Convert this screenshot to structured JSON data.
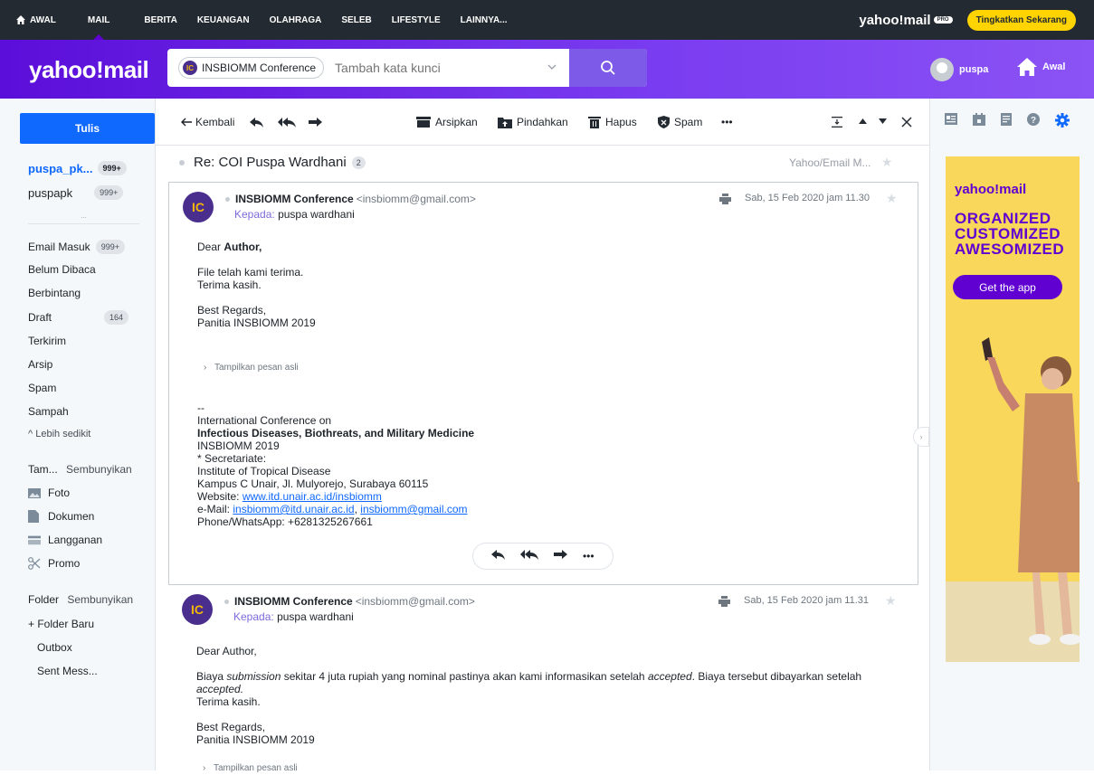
{
  "topnav": {
    "items": [
      "AWAL",
      "MAIL",
      "BERITA",
      "KEUANGAN",
      "OLAHRAGA",
      "SELEB",
      "LIFESTYLE",
      "LAINNYA..."
    ],
    "brand": "yahoo!mail",
    "pro": "PRO",
    "upgrade": "Tingkatkan Sekarang"
  },
  "header": {
    "logo": "yahoo!mail",
    "search_chip": "INSBIOMM Conference",
    "chip_avatar": "IC",
    "search_placeholder": "Tambah kata kunci",
    "user": "puspa",
    "home": "Awal"
  },
  "sidebar": {
    "compose": "Tulis",
    "accounts": [
      {
        "name": "puspa_pk...",
        "badge": "999+"
      },
      {
        "name": "puspapk",
        "badge": "999+"
      }
    ],
    "more": "...",
    "folders": [
      {
        "label": "Email Masuk",
        "badge": "999+"
      },
      {
        "label": "Belum Dibaca",
        "badge": ""
      },
      {
        "label": "Berbintang",
        "badge": ""
      },
      {
        "label": "Draft",
        "badge": "164"
      },
      {
        "label": "Terkirim",
        "badge": ""
      },
      {
        "label": "Arsip",
        "badge": ""
      },
      {
        "label": "Spam",
        "badge": ""
      },
      {
        "label": "Sampah",
        "badge": ""
      }
    ],
    "less": "^ Lebih sedikit",
    "views_title": "Tam...",
    "views_hide": "Sembunyikan",
    "views": [
      "Foto",
      "Dokumen",
      "Langganan",
      "Promo"
    ],
    "folder_title": "Folder",
    "folder_hide": "Sembunyikan",
    "new_folder": "+ Folder Baru",
    "custom_folders": [
      "Outbox",
      "Sent Mess..."
    ]
  },
  "toolbar": {
    "back": "Kembali",
    "archive": "Arsipkan",
    "move": "Pindahkan",
    "delete": "Hapus",
    "spam": "Spam",
    "more": "•••"
  },
  "thread": {
    "subject": "Re: COI Puspa Wardhani",
    "count": "2",
    "folder": "Yahoo/Email M...",
    "messages": [
      {
        "avatar": "IC",
        "sender": "INSBIOMM Conference",
        "email": "<insbiomm@gmail.com>",
        "to_label": "Kepada:",
        "to": "puspa wardhani",
        "date": "Sab, 15 Feb 2020 jam 11.30",
        "greeting": "Dear",
        "greeting_bold": "Author,",
        "line1": "File telah kami terima.",
        "line2": "Terima kasih.",
        "regards1": "Best Regards,",
        "regards2": "Panitia INSBIOMM 2019",
        "show_original": "Tampilkan pesan asli",
        "sig_dash": "--",
        "sig1": "International Conference on",
        "sig2": "Infectious Diseases, Biothreats, and Military Medicine",
        "sig3": "INSBIOMM 2019",
        "sig4": "* Secretariate:",
        "sig5": "Institute of Tropical Disease",
        "sig6": "Kampus C Unair, Jl. Mulyorejo, Surabaya 60115",
        "sig_web_label": "Website:",
        "sig_web": "www.itd.unair.ac.id/insbiomm",
        "sig_mail_label": "e-Mail:",
        "sig_mail1": "insbiomm@itd.unair.ac.id",
        "sig_mail2": "insbiomm@gmail.com",
        "sig_phone": "Phone/WhatsApp: +6281325267661"
      },
      {
        "avatar": "IC",
        "sender": "INSBIOMM Conference",
        "email": "<insbiomm@gmail.com>",
        "to_label": "Kepada:",
        "to": "puspa wardhani",
        "date": "Sab, 15 Feb 2020 jam 11.31",
        "greeting": "Dear Author,",
        "p1_a": "Biaya ",
        "p1_b": "submission",
        "p1_c": " sekitar 4 juta rupiah yang nominal pastinya akan kami informasikan setelah ",
        "p1_d": "accepted",
        "p1_e": ". Biaya tersebut dibayarkan setelah",
        "p1_f": "accepted.",
        "p1_g": "Terima kasih.",
        "regards1": "Best Regards,",
        "regards2": "Panitia INSBIOMM 2019",
        "show_original": "Tampilkan pesan asli"
      }
    ]
  },
  "ad": {
    "logo": "yahoo!mail",
    "line1": "ORGANIZED",
    "line2": "CUSTOMIZED",
    "line3": "AWESOMIZED",
    "cta": "Get the app"
  },
  "colors": {
    "brand_purple": "#6001d2",
    "link_blue": "#0f69ff",
    "upgrade_yellow": "#ffd400"
  }
}
